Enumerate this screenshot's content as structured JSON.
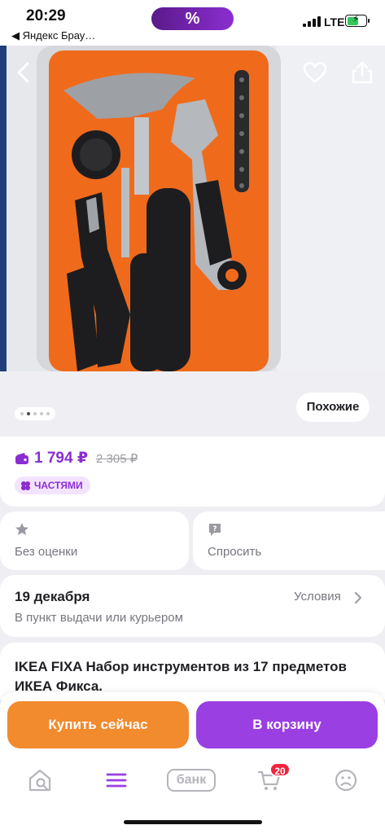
{
  "status_bar": {
    "time": "20:29",
    "back_app": "◀ Яндекс Брау…",
    "promo_symbol": "%",
    "network": "LTE",
    "icons": [
      "signal-icon",
      "battery-charging-icon"
    ]
  },
  "hero": {
    "icons": [
      "back-icon",
      "heart-icon",
      "share-icon"
    ],
    "gallery_pages": 5,
    "gallery_active_index": 1,
    "similar_label": "Похожие"
  },
  "price": {
    "current": "1 794 ₽",
    "old": "2 305 ₽",
    "installments_label": "ЧАСТЯМИ",
    "accent_color": "#8b2ed1"
  },
  "info": {
    "rating_label": "Без оценки",
    "ask_label": "Спросить"
  },
  "delivery": {
    "date": "19 декабря",
    "subtitle": "В пункт выдачи или курьером",
    "conditions_label": "Условия"
  },
  "product": {
    "title": "IKEA FIXA Набор инструментов из 17 предметов ИКЕА Фикса."
  },
  "actions": {
    "buy_now": "Купить сейчас",
    "add_to_cart": "В корзину",
    "buy_color": "#f28a2e",
    "cart_color": "#9a3fe2"
  },
  "tabbar": {
    "items": [
      "home-search-icon",
      "catalog-menu-icon",
      "bank-icon",
      "cart-icon",
      "profile-icon"
    ],
    "bank_label": "банк",
    "cart_badge": "20"
  }
}
